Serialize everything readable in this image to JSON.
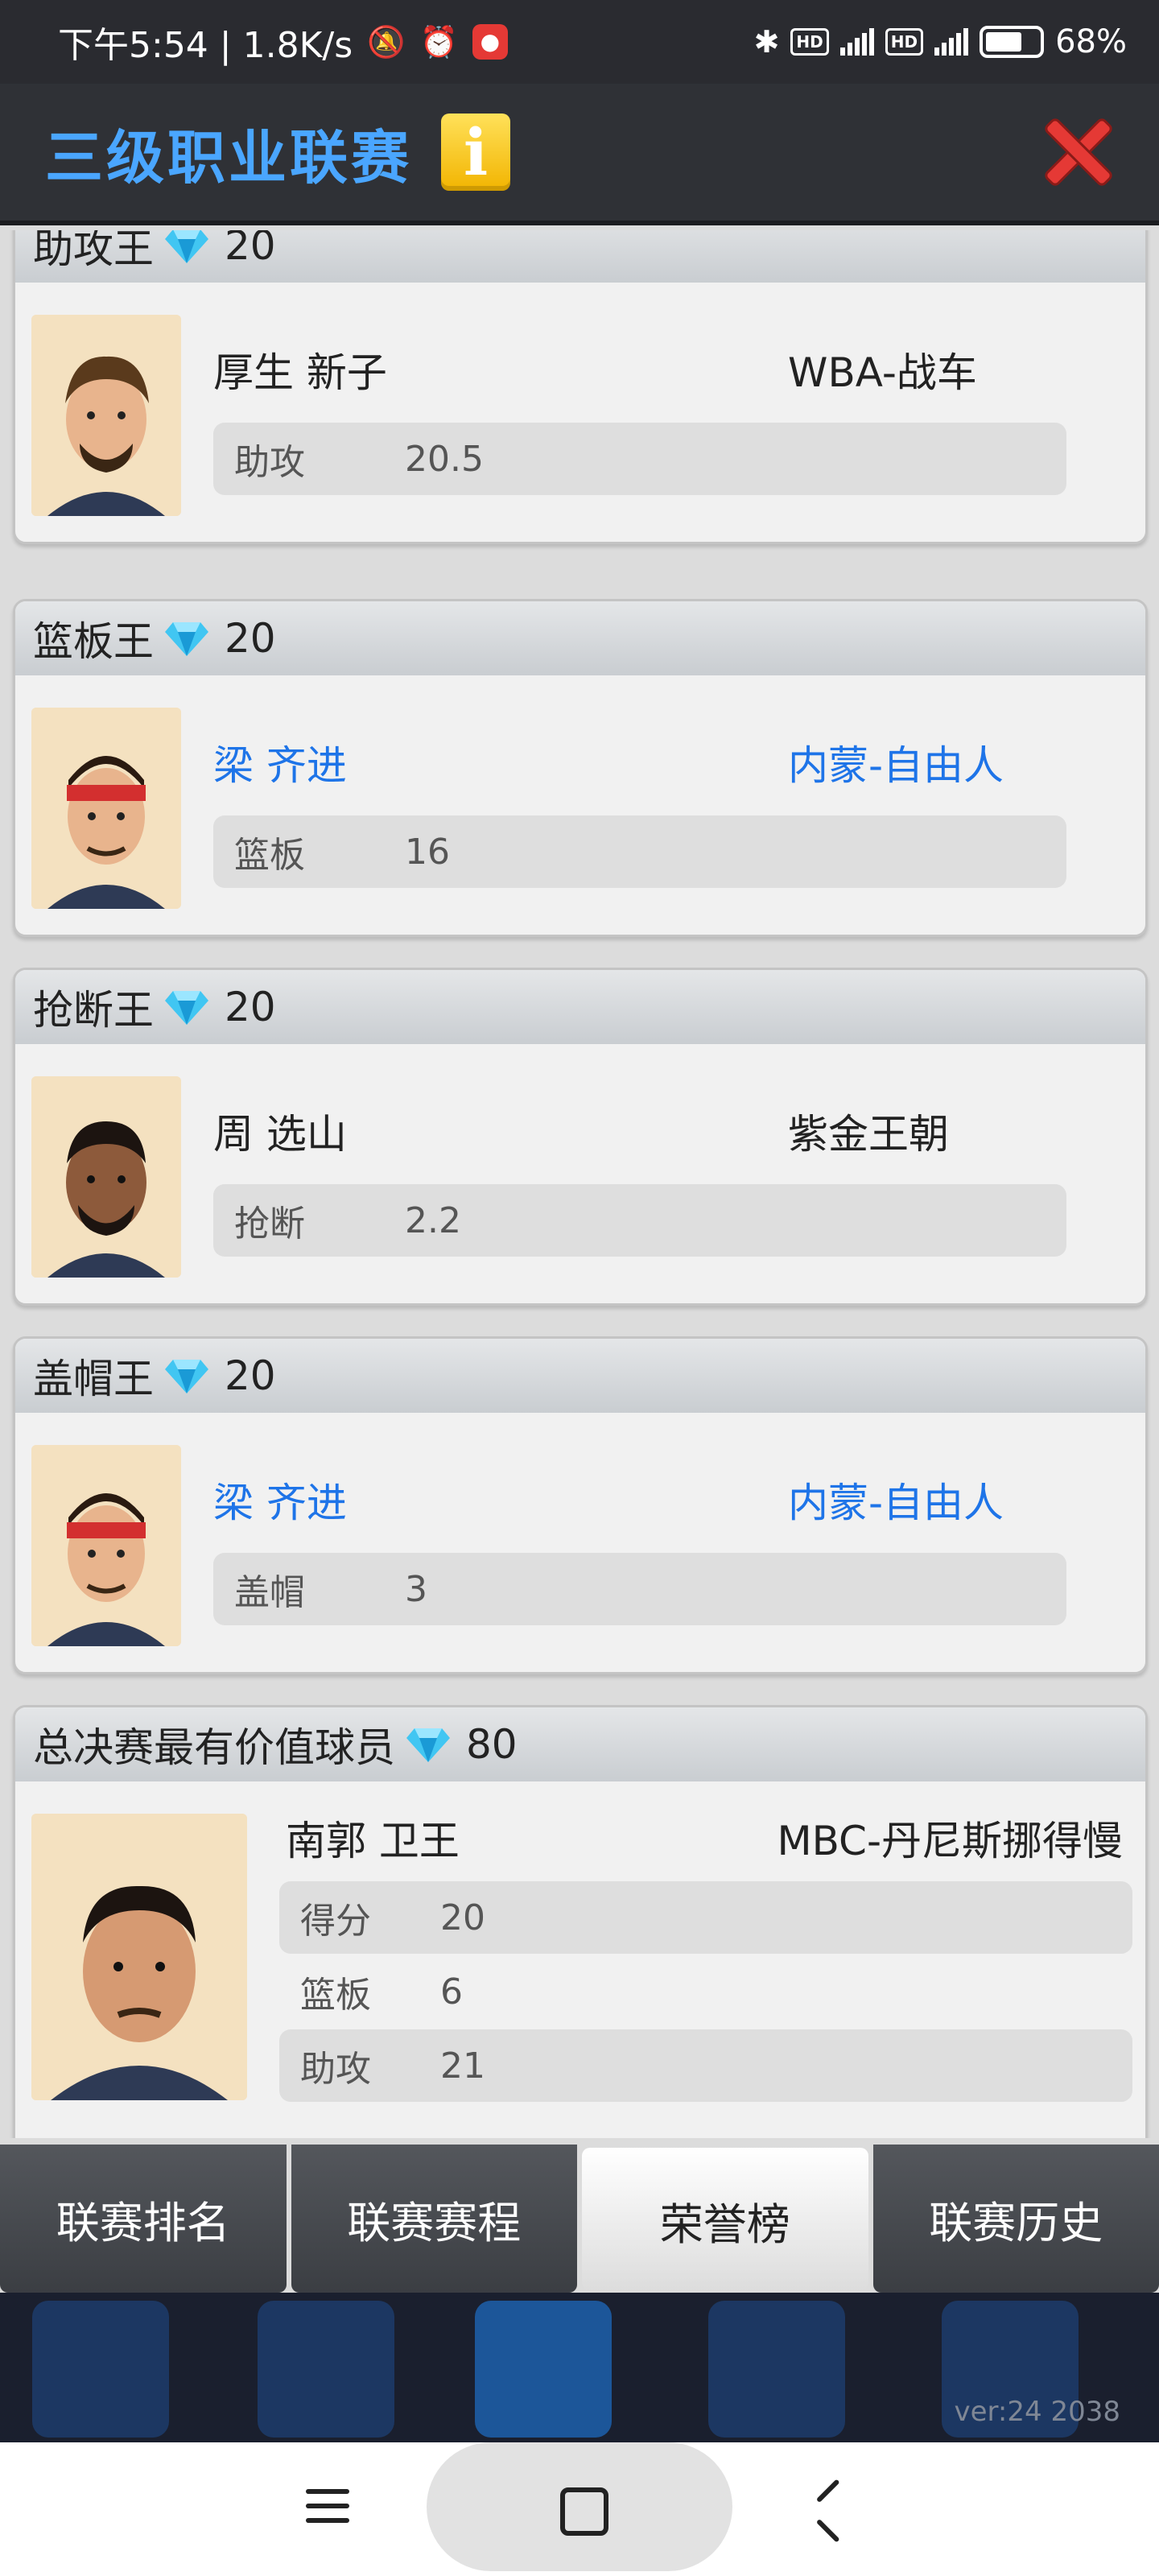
{
  "status_bar": {
    "time_speed": "下午5:54 | 1.8K/s",
    "battery": "68%",
    "icons": [
      "mute-icon",
      "alarm-icon",
      "app-notification-icon",
      "bluetooth-icon",
      "hd-icon",
      "5g-signal-icon",
      "battery-icon"
    ]
  },
  "header": {
    "title": "三级职业联赛",
    "info_label": "i",
    "colors": {
      "title": "#4aa6ff",
      "close": "#e53935",
      "info": "#f2b400"
    }
  },
  "awards": [
    {
      "title": "助攻王",
      "reward": "20",
      "player": "厚生 新子",
      "team": "WBA-战车",
      "highlight": false,
      "stats": [
        {
          "label": "助攻",
          "value": "20.5"
        }
      ]
    },
    {
      "title": "篮板王",
      "reward": "20",
      "player": "梁 齐进",
      "team": "内蒙-自由人",
      "highlight": true,
      "stats": [
        {
          "label": "篮板",
          "value": "16"
        }
      ]
    },
    {
      "title": "抢断王",
      "reward": "20",
      "player": "周 选山",
      "team": "紫金王朝",
      "highlight": false,
      "stats": [
        {
          "label": "抢断",
          "value": "2.2"
        }
      ]
    },
    {
      "title": "盖帽王",
      "reward": "20",
      "player": "梁 齐进",
      "team": "内蒙-自由人",
      "highlight": true,
      "stats": [
        {
          "label": "盖帽",
          "value": "3"
        }
      ]
    },
    {
      "title": "总决赛最有价值球员",
      "reward": "80",
      "player": "南郭 卫王",
      "team": "MBC-丹尼斯挪得慢",
      "highlight": false,
      "stats": [
        {
          "label": "得分",
          "value": "20"
        },
        {
          "label": "篮板",
          "value": "6"
        },
        {
          "label": "助攻",
          "value": "21"
        }
      ]
    }
  ],
  "tabs": [
    {
      "label": "联赛排名",
      "active": false
    },
    {
      "label": "联赛赛程",
      "active": false
    },
    {
      "label": "荣誉榜",
      "active": true
    },
    {
      "label": "联赛历史",
      "active": false
    }
  ],
  "version": "ver:24  2038",
  "highlight_color": "#1e74e8"
}
